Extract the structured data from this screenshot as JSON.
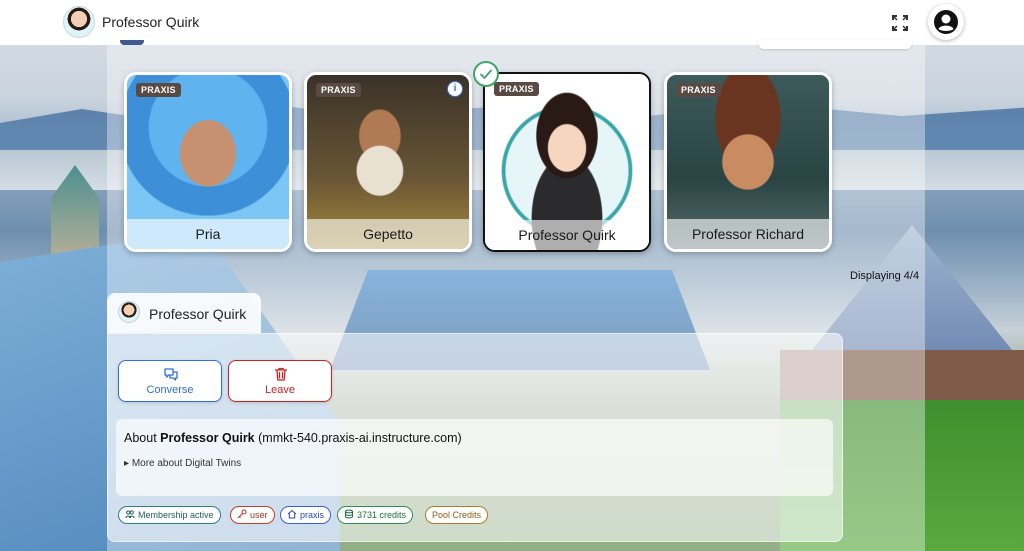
{
  "app": {
    "title": "Professor Quirk"
  },
  "topbar": {
    "expand_icon": "expand-icon",
    "account_icon": "account-circle-icon"
  },
  "cards": [
    {
      "name": "Pria",
      "badge": "PRAXIS",
      "selected": false,
      "info": false
    },
    {
      "name": "Gepetto",
      "badge": "PRAXIS",
      "selected": false,
      "info": true,
      "info_label": "i"
    },
    {
      "name": "Professor Quirk",
      "badge": "PRAXIS",
      "selected": true,
      "info": false
    },
    {
      "name": "Professor Richard",
      "badge": "PRAXIS",
      "selected": false,
      "info": false
    }
  ],
  "displaying": "Displaying 4/4",
  "detail": {
    "tab_name": "Professor Quirk",
    "converse_label": "Converse",
    "leave_label": "Leave",
    "about_prefix": "About",
    "about_name": "Professor Quirk",
    "about_domain": "(mmkt-540.praxis-ai.instructure.com)",
    "more_label": "More about Digital Twins",
    "pills": {
      "membership": "Membership active",
      "user": "user",
      "praxis": "praxis",
      "credits": "3731 credits",
      "pool": "Pool Credits"
    }
  },
  "colors": {
    "converse": "#2f6fd6",
    "leave": "#d02020",
    "check": "#3fa36b",
    "badge": "#5a4a44"
  }
}
